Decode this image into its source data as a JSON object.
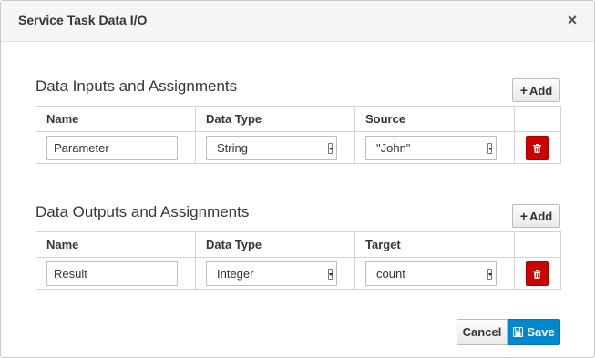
{
  "dialog": {
    "title": "Service Task Data I/O",
    "close_label": "×"
  },
  "inputs": {
    "title": "Data Inputs and Assignments",
    "add_label": "Add",
    "columns": [
      "Name",
      "Data Type",
      "Source"
    ],
    "rows": [
      {
        "name": "Parameter",
        "data_type": "String",
        "source": "\"John\""
      }
    ]
  },
  "outputs": {
    "title": "Data Outputs and Assignments",
    "add_label": "Add",
    "columns": [
      "Name",
      "Data Type",
      "Target"
    ],
    "rows": [
      {
        "name": "Result",
        "data_type": "Integer",
        "target": "count"
      }
    ]
  },
  "footer": {
    "cancel_label": "Cancel",
    "save_label": "Save"
  },
  "colors": {
    "delete": "#cc0000",
    "primary": "#0088ce"
  },
  "icons": {
    "close": "close-icon",
    "add": "plus-icon",
    "delete": "trash-icon",
    "save": "floppy-disk-icon",
    "dropdown": "dropdown-arrow-icon"
  }
}
